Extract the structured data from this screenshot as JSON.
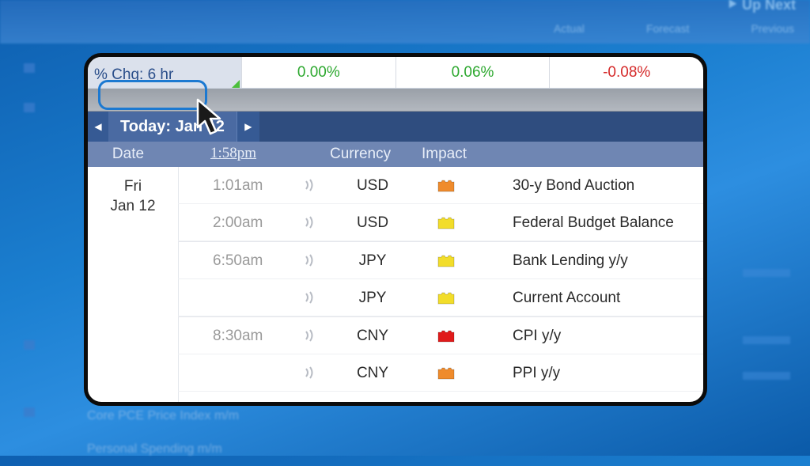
{
  "background": {
    "next_label": "⯈ Up Next",
    "col_headers": [
      "Actual",
      "Forecast",
      "Previous"
    ],
    "rows": [
      "Core PCE Price Index m/m",
      "Personal Spending m/m"
    ]
  },
  "change_row": {
    "label": "% Chg: 6 hr",
    "values": [
      "0.00%",
      "0.06%",
      "-0.08%"
    ],
    "colors": [
      "#2da82f",
      "#2da82f",
      "#d52a2a"
    ]
  },
  "nav": {
    "prev_icon": "◀",
    "today_label": "Today: Jan 12",
    "next_icon": "▶"
  },
  "header": {
    "date": "Date",
    "time": "1:58pm",
    "currency": "Currency",
    "impact": "Impact"
  },
  "date_cell": {
    "day": "Fri",
    "date": "Jan 12"
  },
  "events": [
    {
      "time": "1:01am",
      "currency": "USD",
      "impact": "orange",
      "event": "30-y Bond Auction"
    },
    {
      "time": "2:00am",
      "currency": "USD",
      "impact": "yellow",
      "event": "Federal Budget Balance"
    },
    {
      "time": "6:50am",
      "currency": "JPY",
      "impact": "yellow",
      "event": "Bank Lending y/y"
    },
    {
      "time": "",
      "currency": "JPY",
      "impact": "yellow",
      "event": "Current Account"
    },
    {
      "time": "8:30am",
      "currency": "CNY",
      "impact": "red",
      "event": "CPI y/y"
    },
    {
      "time": "",
      "currency": "CNY",
      "impact": "orange",
      "event": "PPI y/y"
    }
  ],
  "impact_colors": {
    "red": "#e01b1b",
    "orange": "#ef8b2c",
    "yellow": "#f2dd2a"
  }
}
